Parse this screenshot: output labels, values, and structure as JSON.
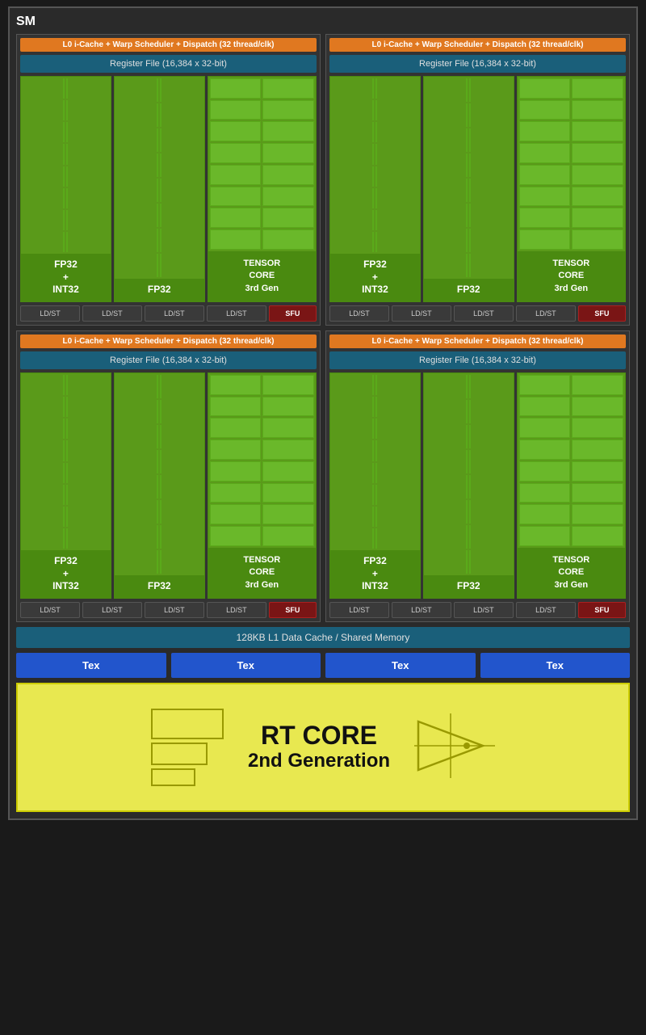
{
  "sm_label": "SM",
  "l0_bar_text": "L0 i-Cache + Warp Scheduler + Dispatch (32 thread/clk)",
  "register_file_text": "Register File (16,384 x 32-bit)",
  "fp32_label_1": "FP32\n+\nINT32",
  "fp32_label_2": "FP32",
  "tensor_label": "TENSOR\nCORE\n3rd Gen",
  "ldst_labels": [
    "LD/ST",
    "LD/ST",
    "LD/ST",
    "LD/ST"
  ],
  "sfu_label": "SFU",
  "shared_memory_text": "128KB L1 Data Cache / Shared Memory",
  "tex_labels": [
    "Tex",
    "Tex",
    "Tex",
    "Tex"
  ],
  "rt_core_title": "RT CORE",
  "rt_core_subtitle": "2nd Generation"
}
